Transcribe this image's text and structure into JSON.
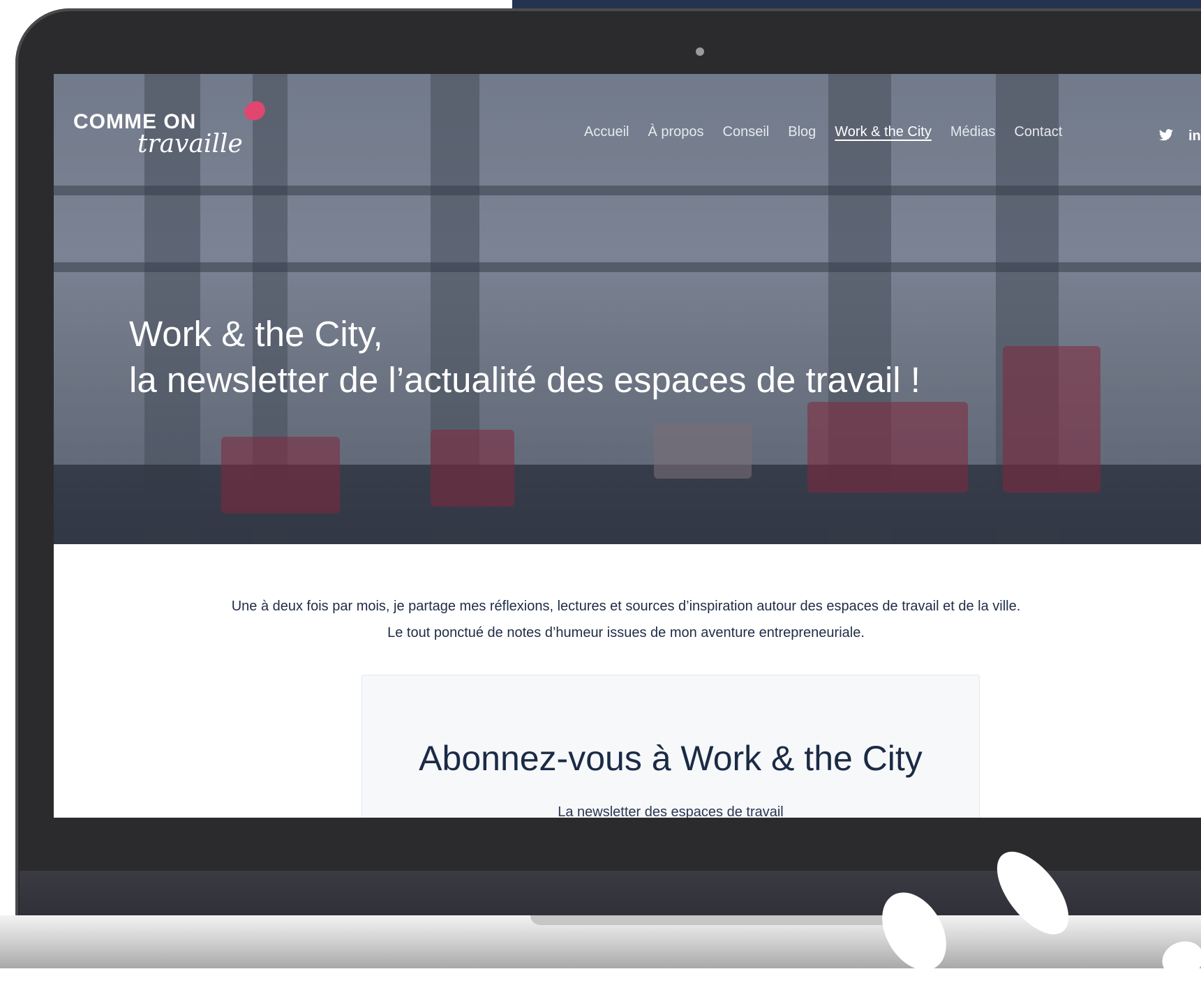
{
  "site": {
    "logo_line1": "COMME ON",
    "logo_line2": "travaille",
    "nav": [
      {
        "label": "Accueil",
        "active": false
      },
      {
        "label": "À propos",
        "active": false
      },
      {
        "label": "Conseil",
        "active": false
      },
      {
        "label": "Blog",
        "active": false
      },
      {
        "label": "Work & the City",
        "active": true
      },
      {
        "label": "Médias",
        "active": false
      },
      {
        "label": "Contact",
        "active": false
      }
    ],
    "social": {
      "twitter": "twitter-icon",
      "linkedin": "linkedin-icon"
    }
  },
  "hero": {
    "line1": "Work & the City,",
    "line2": "la newsletter de l’actualité des espaces de travail !"
  },
  "intro": {
    "line1": "Une à deux fois par mois, je partage mes réflexions, lectures et sources d’inspiration autour des espaces de travail et de la ville.",
    "line2": "Le tout ponctué de notes d’humeur issues de mon aventure entrepreneuriale."
  },
  "subscribe": {
    "title": "Abonnez-vous à Work & the City",
    "subtitle": "La newsletter des espaces de travail"
  },
  "colors": {
    "accent": "#e0466e",
    "navy": "#1b2a45",
    "laptop": "#2b2b2d"
  }
}
